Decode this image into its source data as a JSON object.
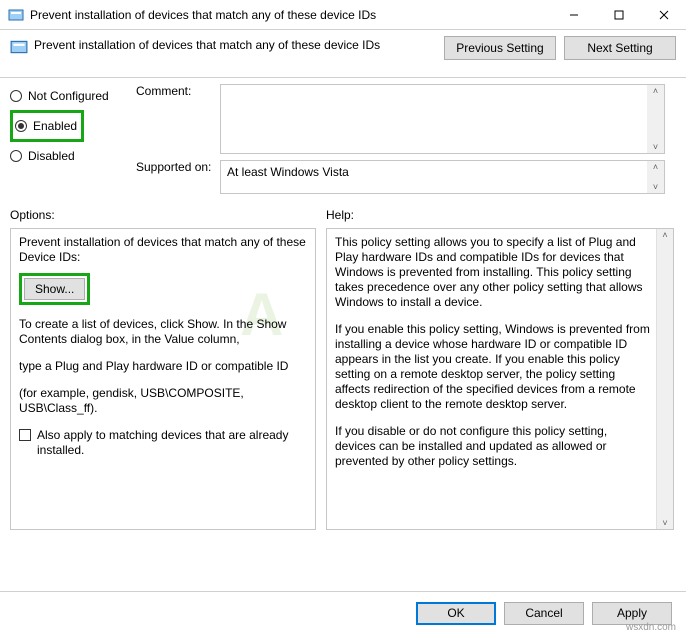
{
  "window": {
    "title": "Prevent installation of devices that match any of these device IDs"
  },
  "header": {
    "title": "Prevent installation of devices that match any of these device IDs",
    "prev": "Previous Setting",
    "next": "Next Setting"
  },
  "config": {
    "not_configured": "Not Configured",
    "enabled": "Enabled",
    "disabled": "Disabled",
    "comment_label": "Comment:",
    "comment_value": "",
    "supported_label": "Supported on:",
    "supported_value": "At least Windows Vista"
  },
  "labels": {
    "options": "Options:",
    "help": "Help:"
  },
  "options": {
    "subhead": "Prevent installation of devices that match any of these Device IDs:",
    "show_btn": "Show...",
    "line1": "To create a list of devices, click Show. In the Show Contents dialog box, in the Value column,",
    "line2": "type a Plug and Play hardware ID or compatible ID",
    "line3": "(for example, gendisk, USB\\COMPOSITE, USB\\Class_ff).",
    "checkbox": "Also apply to matching devices that are already installed."
  },
  "help": {
    "p1": "This policy setting allows you to specify a list of Plug and Play hardware IDs and compatible IDs for devices that Windows is prevented from installing. This policy setting takes precedence over any other policy setting that allows Windows to install a device.",
    "p2": "If you enable this policy setting, Windows is prevented from installing a device whose hardware ID or compatible ID appears in the list you create. If you enable this policy setting on a remote desktop server, the policy setting affects redirection of the specified devices from a remote desktop client to the remote desktop server.",
    "p3": "If you disable or do not configure this policy setting, devices can be installed and updated as allowed or prevented by other policy settings."
  },
  "footer": {
    "ok": "OK",
    "cancel": "Cancel",
    "apply": "Apply"
  },
  "watermark": "wsxdn.com"
}
